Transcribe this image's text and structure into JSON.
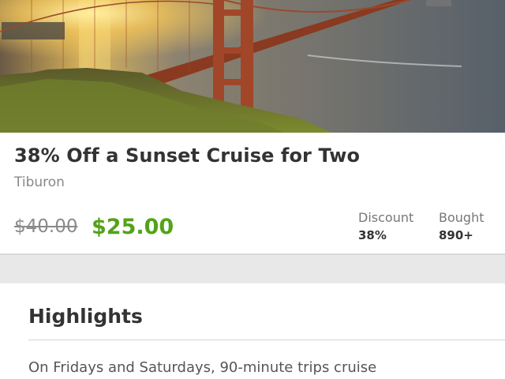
{
  "deal": {
    "title": "38% Off a Sunset Cruise for Two",
    "location": "Tiburon",
    "original_price": "$40.00",
    "sale_price": "$25.00",
    "stats": {
      "discount_label": "Discount",
      "discount_value": "38%",
      "bought_label": "Bought",
      "bought_value": "890+"
    }
  },
  "highlights": {
    "title": "Highlights",
    "text": "On Fridays and Saturdays, 90-minute trips cruise"
  },
  "colors": {
    "sale_price": "#53a318",
    "strikethrough_price": "#8a8a8a",
    "page_background": "#e8e8e8"
  }
}
